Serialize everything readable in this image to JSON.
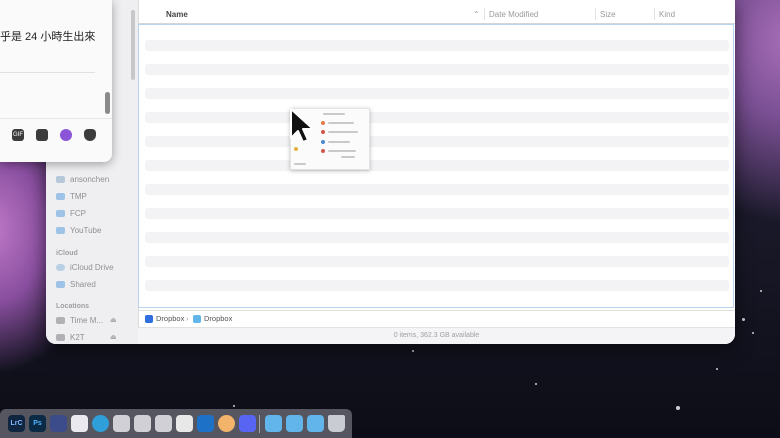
{
  "chat": {
    "message": "乎是 24 小時生出來",
    "toolbar": [
      "gif-icon",
      "sticker-icon",
      "emoji-icon",
      "game-controller-icon"
    ],
    "gif_label": "GIF"
  },
  "finder": {
    "sidebar": {
      "items": [
        "ansonchen",
        "TMP",
        "FCP",
        "YouTube"
      ],
      "icloud_header": "iCloud",
      "icloud_items": [
        "iCloud Drive",
        "Shared"
      ],
      "locations_header": "Locations",
      "location_items": [
        "Time M...",
        "K2T"
      ]
    },
    "columns": {
      "name": "Name",
      "date_modified": "Date Modified",
      "size": "Size",
      "kind": "Kind"
    },
    "path": {
      "root": "Dropbox",
      "separator": "›",
      "current": "Dropbox"
    },
    "status": "0 items, 362.3 GB available"
  },
  "dock": {
    "apps": [
      {
        "name": "lightroom-classic-icon",
        "label": "LrC",
        "color": "#0f2540"
      },
      {
        "name": "photoshop-icon",
        "label": "Ps",
        "color": "#0b2a45"
      },
      {
        "name": "figma-icon",
        "label": "",
        "color": "#3c4b8a"
      },
      {
        "name": "reeder-icon",
        "label": "",
        "color": "#e9e9ef"
      },
      {
        "name": "telegram-icon",
        "label": "",
        "color": "#2f9fd9"
      },
      {
        "name": "package-icon-1",
        "label": "",
        "color": "#d0d0d6"
      },
      {
        "name": "package-icon-2",
        "label": "",
        "color": "#d0d0d6"
      },
      {
        "name": "package-icon-3",
        "label": "",
        "color": "#d0d0d6"
      },
      {
        "name": "chatgpt-icon",
        "label": "",
        "color": "#e8e8e8"
      },
      {
        "name": "trello-icon",
        "label": "",
        "color": "#1d72c8"
      },
      {
        "name": "photos-icon",
        "label": "",
        "color": "#f2b36a"
      },
      {
        "name": "discord-icon",
        "label": "",
        "color": "#5865f2"
      },
      {
        "name": "applications-folder-icon",
        "label": "",
        "color": "#62b5ea"
      },
      {
        "name": "documents-folder-icon",
        "label": "",
        "color": "#62b5ea"
      },
      {
        "name": "downloads-folder-icon",
        "label": "",
        "color": "#62b5ea"
      },
      {
        "name": "trash-icon",
        "label": "",
        "color": "#c9ccd3"
      }
    ]
  }
}
